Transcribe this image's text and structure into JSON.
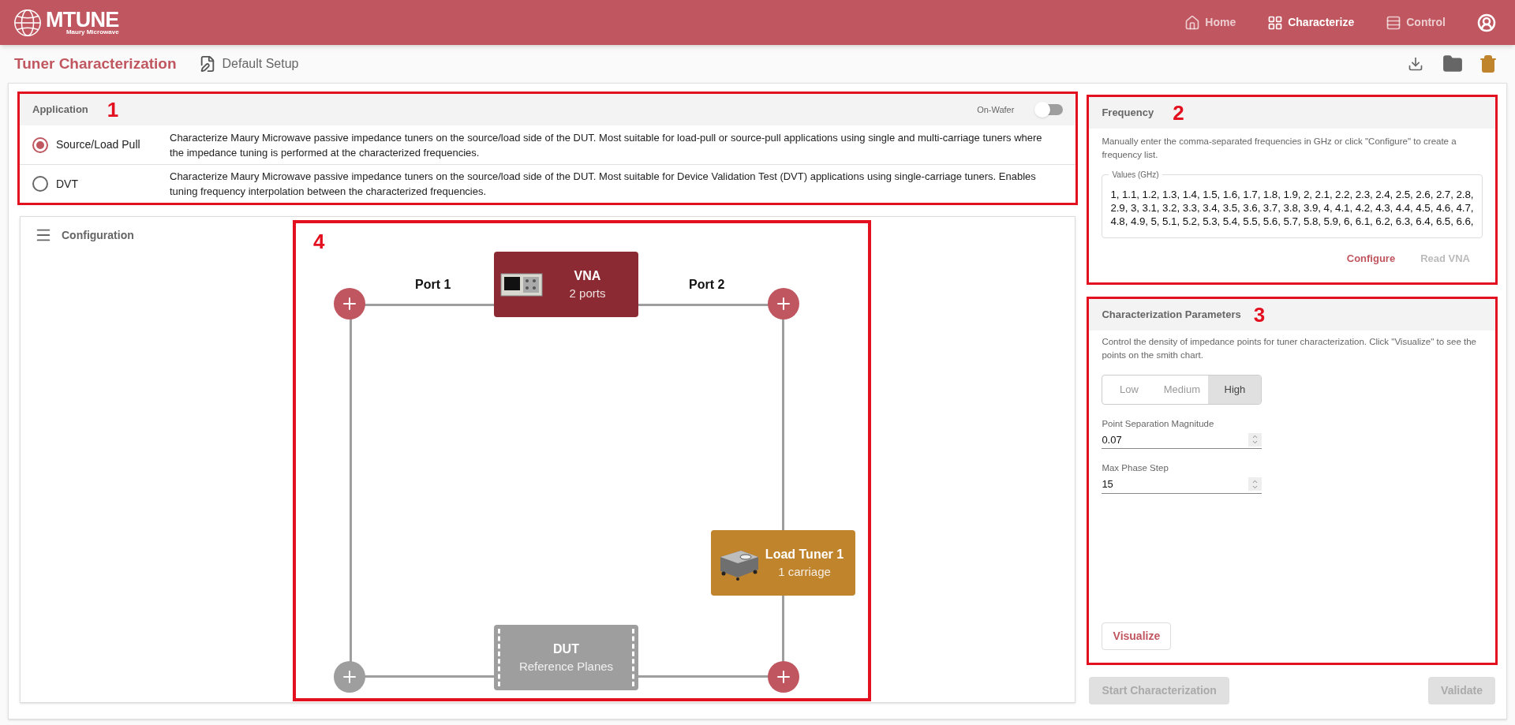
{
  "header": {
    "logo": {
      "name": "MTUNE",
      "tagline": "Maury Microwave"
    },
    "nav": [
      {
        "label": "Home",
        "selected": false
      },
      {
        "label": "Characterize",
        "selected": true
      },
      {
        "label": "Control",
        "selected": false
      }
    ]
  },
  "toolbar": {
    "title": "Tuner Characterization",
    "setup": "Default Setup"
  },
  "application": {
    "title": "Application",
    "callout": "1",
    "toggle": {
      "label": "On-Wafer",
      "on": false
    },
    "options": [
      {
        "label": "Source/Load Pull",
        "selected": true,
        "description": "Characterize Maury Microwave passive impedance tuners on the source/load side of the DUT. Most suitable for load-pull or source-pull applications using single and multi-carriage tuners where the impedance tuning is performed at the characterized frequencies."
      },
      {
        "label": "DVT",
        "selected": false,
        "description": "Characterize Maury Microwave passive impedance tuners on the source/load side of the DUT. Most suitable for Device Validation Test (DVT) applications using single-carriage tuners. Enables tuning frequency interpolation between the characterized frequencies."
      }
    ]
  },
  "configuration": {
    "title": "Configuration",
    "callout": "4",
    "ports": [
      "Port 1",
      "Port 2"
    ],
    "nodes": [
      {
        "kind": "instrument",
        "title": "VNA",
        "subtitle": "2 ports"
      },
      {
        "kind": "tuner",
        "title": "Load Tuner 1",
        "subtitle": "1 carriage"
      },
      {
        "kind": "dut",
        "title": "DUT",
        "subtitle": "Reference Planes"
      }
    ],
    "add_buttons": [
      {
        "disabled": false
      },
      {
        "disabled": false
      },
      {
        "disabled": true
      },
      {
        "disabled": false
      }
    ]
  },
  "frequency": {
    "title": "Frequency",
    "callout": "2",
    "description": "Manually enter the comma-separated frequencies in GHz or click \"Configure\" to create a frequency list.",
    "field_label": "Values (GHz)",
    "value": "1, 1.1, 1.2, 1.3, 1.4, 1.5, 1.6, 1.7, 1.8, 1.9, 2, 2.1, 2.2, 2.3, 2.4, 2.5, 2.6, 2.7, 2.8, 2.9, 3, 3.1, 3.2, 3.3, 3.4, 3.5, 3.6, 3.7, 3.8, 3.9, 4, 4.1, 4.2, 4.3, 4.4, 4.5, 4.6, 4.7, 4.8, 4.9, 5, 5.1, 5.2, 5.3, 5.4, 5.5, 5.6, 5.7, 5.8, 5.9, 6, 6.1, 6.2, 6.3, 6.4, 6.5, 6.6,",
    "buttons": [
      {
        "label": "Configure",
        "disabled": false
      },
      {
        "label": "Read VNA",
        "disabled": true
      }
    ]
  },
  "parameters": {
    "title": "Characterization Parameters",
    "callout": "3",
    "description": "Control the density of impedance points for tuner characterization. Click \"Visualize\" to see the points on the smith chart.",
    "density": [
      {
        "label": "Low",
        "selected": false
      },
      {
        "label": "Medium",
        "selected": false
      },
      {
        "label": "High",
        "selected": true
      }
    ],
    "fields": [
      {
        "label": "Point Separation Magnitude",
        "value": "0.07"
      },
      {
        "label": "Max Phase Step",
        "value": "15"
      }
    ],
    "visualize": "Visualize"
  },
  "actions": [
    {
      "label": "Start Characterization",
      "disabled": true
    },
    {
      "label": "Validate",
      "disabled": true
    }
  ]
}
